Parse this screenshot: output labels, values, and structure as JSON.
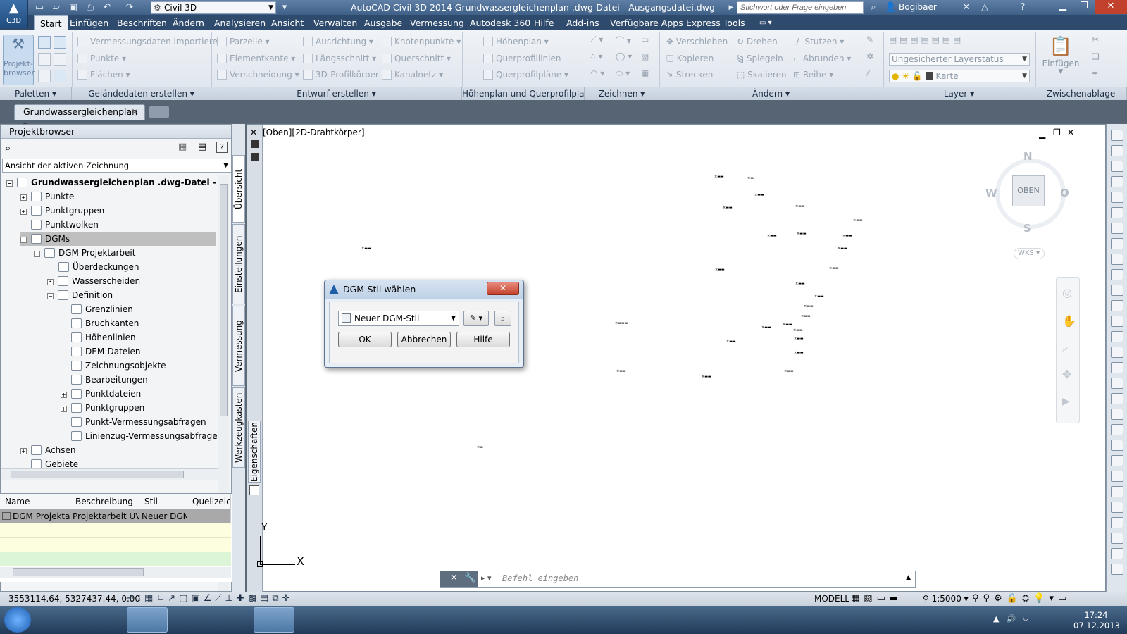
{
  "title_bar": {
    "app_label": "C3D",
    "workspace": "Civil 3D",
    "window_title": "AutoCAD Civil 3D 2014   Grundwassergleichenplan .dwg-Datei - Ausgangsdatei.dwg",
    "search_placeholder": "Stichwort oder Frage eingeben",
    "user": "Bogibaer"
  },
  "menu_tabs": [
    "Start",
    "Einfügen",
    "Beschriften",
    "Ändern",
    "Analysieren",
    "Ansicht",
    "Verwalten",
    "Ausgabe",
    "Vermessung",
    "Autodesk 360",
    "Hilfe",
    "Add-ins",
    "Verfügbare Apps",
    "Express Tools"
  ],
  "ribbon": {
    "panels": [
      "Paletten",
      "Geländedaten erstellen",
      "Entwurf erstellen",
      "Höhenplan und Querprofilplan",
      "Zeichnen",
      "Ändern",
      "Layer",
      "Zwischenablage"
    ],
    "palette_button": "Projekt-browser",
    "gelaende": [
      "Vermessungsdaten importieren",
      "Punkte",
      "Flächen"
    ],
    "entwurf_col1": [
      "Parzelle",
      "Elementkante",
      "Verschneidung"
    ],
    "entwurf_col2": [
      "Ausrichtung",
      "Längsschnitt",
      "3D-Profilkörper"
    ],
    "entwurf_col3": [
      "Knotenpunkte",
      "Querschnitt",
      "Kanalnetz"
    ],
    "hoehenplan": [
      "Höhenplan",
      "Querprofillinien",
      "Querprofilpläne"
    ],
    "aendern_col1": [
      "Verschieben",
      "Kopieren",
      "Strecken"
    ],
    "aendern_col2": [
      "Drehen",
      "Spiegeln",
      "Skalieren"
    ],
    "aendern_col3": [
      "Stutzen",
      "Abrunden",
      "Reihe"
    ],
    "layer_status": "Ungesicherter Layerstatus",
    "layer_name": "Karte",
    "paste": "Einfügen"
  },
  "doc_tab": "Grundwassergleichenplan *",
  "palette": {
    "title": "Projektbrowser",
    "view_select": "Ansicht der aktiven Zeichnung",
    "tree": [
      {
        "label": "Grundwassergleichenplan .dwg-Datei - Ausga...",
        "bold": true
      },
      {
        "label": "Punkte"
      },
      {
        "label": "Punktgruppen"
      },
      {
        "label": "Punktwolken"
      },
      {
        "label": "DGMs"
      },
      {
        "label": "DGM Projektarbeit"
      },
      {
        "label": "Überdeckungen"
      },
      {
        "label": "Wasserscheiden"
      },
      {
        "label": "Definition"
      },
      {
        "label": "Grenzlinien"
      },
      {
        "label": "Bruchkanten"
      },
      {
        "label": "Höhenlinien"
      },
      {
        "label": "DEM-Dateien"
      },
      {
        "label": "Zeichnungsobjekte"
      },
      {
        "label": "Bearbeitungen"
      },
      {
        "label": "Punktdateien"
      },
      {
        "label": "Punktgruppen"
      },
      {
        "label": "Punkt-Vermessungsabfragen"
      },
      {
        "label": "Linienzug-Vermessungsabfragen"
      },
      {
        "label": "Achsen"
      },
      {
        "label": "Gebiete"
      }
    ],
    "side_tabs": [
      "Übersicht",
      "Einstellungen",
      "Vermessung",
      "Werkzeugkasten"
    ],
    "table_headers": [
      "Name",
      "Beschreibung",
      "Stil",
      "Quellzeich"
    ],
    "table_row": [
      "DGM Projekta",
      "Projektarbeit UVV",
      "Neuer DGM",
      ""
    ]
  },
  "drawing": {
    "viewport_label": "[Oben][2D-Drahtkörper]",
    "properties_tab": "Eigenschaften",
    "viewcube": {
      "n": "N",
      "s": "S",
      "w": "W",
      "o": "O",
      "face": "OBEN",
      "wks": "WKS"
    },
    "ucs_x": "X",
    "ucs_y": "Y"
  },
  "dialog": {
    "title": "DGM-Stil wählen",
    "selected_style": "Neuer DGM-Stil",
    "ok": "OK",
    "cancel": "Abbrechen",
    "help": "Hilfe"
  },
  "command_line": {
    "placeholder": "Befehl eingeben"
  },
  "status_bar": {
    "coords": "3553114.64, 5327437.44, 0.00",
    "space": "MODELL",
    "scale": "1:5000"
  },
  "taskbar": {
    "time": "17:24",
    "date": "07.12.2013"
  }
}
